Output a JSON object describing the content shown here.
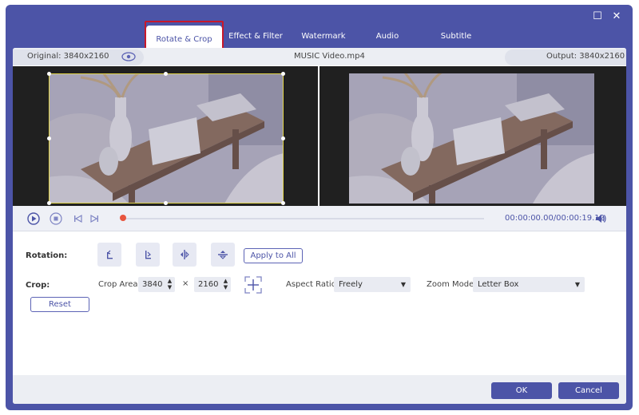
{
  "window": {
    "maximize_glyph": "☐",
    "close_glyph": "✕"
  },
  "tabs": [
    {
      "label": "Rotate & Crop",
      "active": true
    },
    {
      "label": "Effect & Filter",
      "active": false
    },
    {
      "label": "Watermark",
      "active": false
    },
    {
      "label": "Audio",
      "active": false
    },
    {
      "label": "Subtitle",
      "active": false
    }
  ],
  "infobar": {
    "original": "Original: 3840x2160",
    "filename": "MUSIC Video.mp4",
    "output": "Output: 3840x2160"
  },
  "player": {
    "time": "00:00:00.00/00:00:19.12",
    "progress": 0.0
  },
  "rotation": {
    "label": "Rotation:",
    "apply_all": "Apply to All"
  },
  "crop": {
    "label": "Crop:",
    "area_label": "Crop Area:",
    "width": "3840",
    "height": "2160",
    "times": "×",
    "aspect_label": "Aspect Ratio:",
    "aspect_value": "Freely",
    "zoom_label": "Zoom Mode:",
    "zoom_value": "Letter Box",
    "reset": "Reset"
  },
  "footer": {
    "ok": "OK",
    "cancel": "Cancel"
  },
  "colors": {
    "accent": "#4c54a7",
    "highlight": "#c8182a",
    "crop_frame": "#e2d54a",
    "playhead": "#e8553e"
  }
}
